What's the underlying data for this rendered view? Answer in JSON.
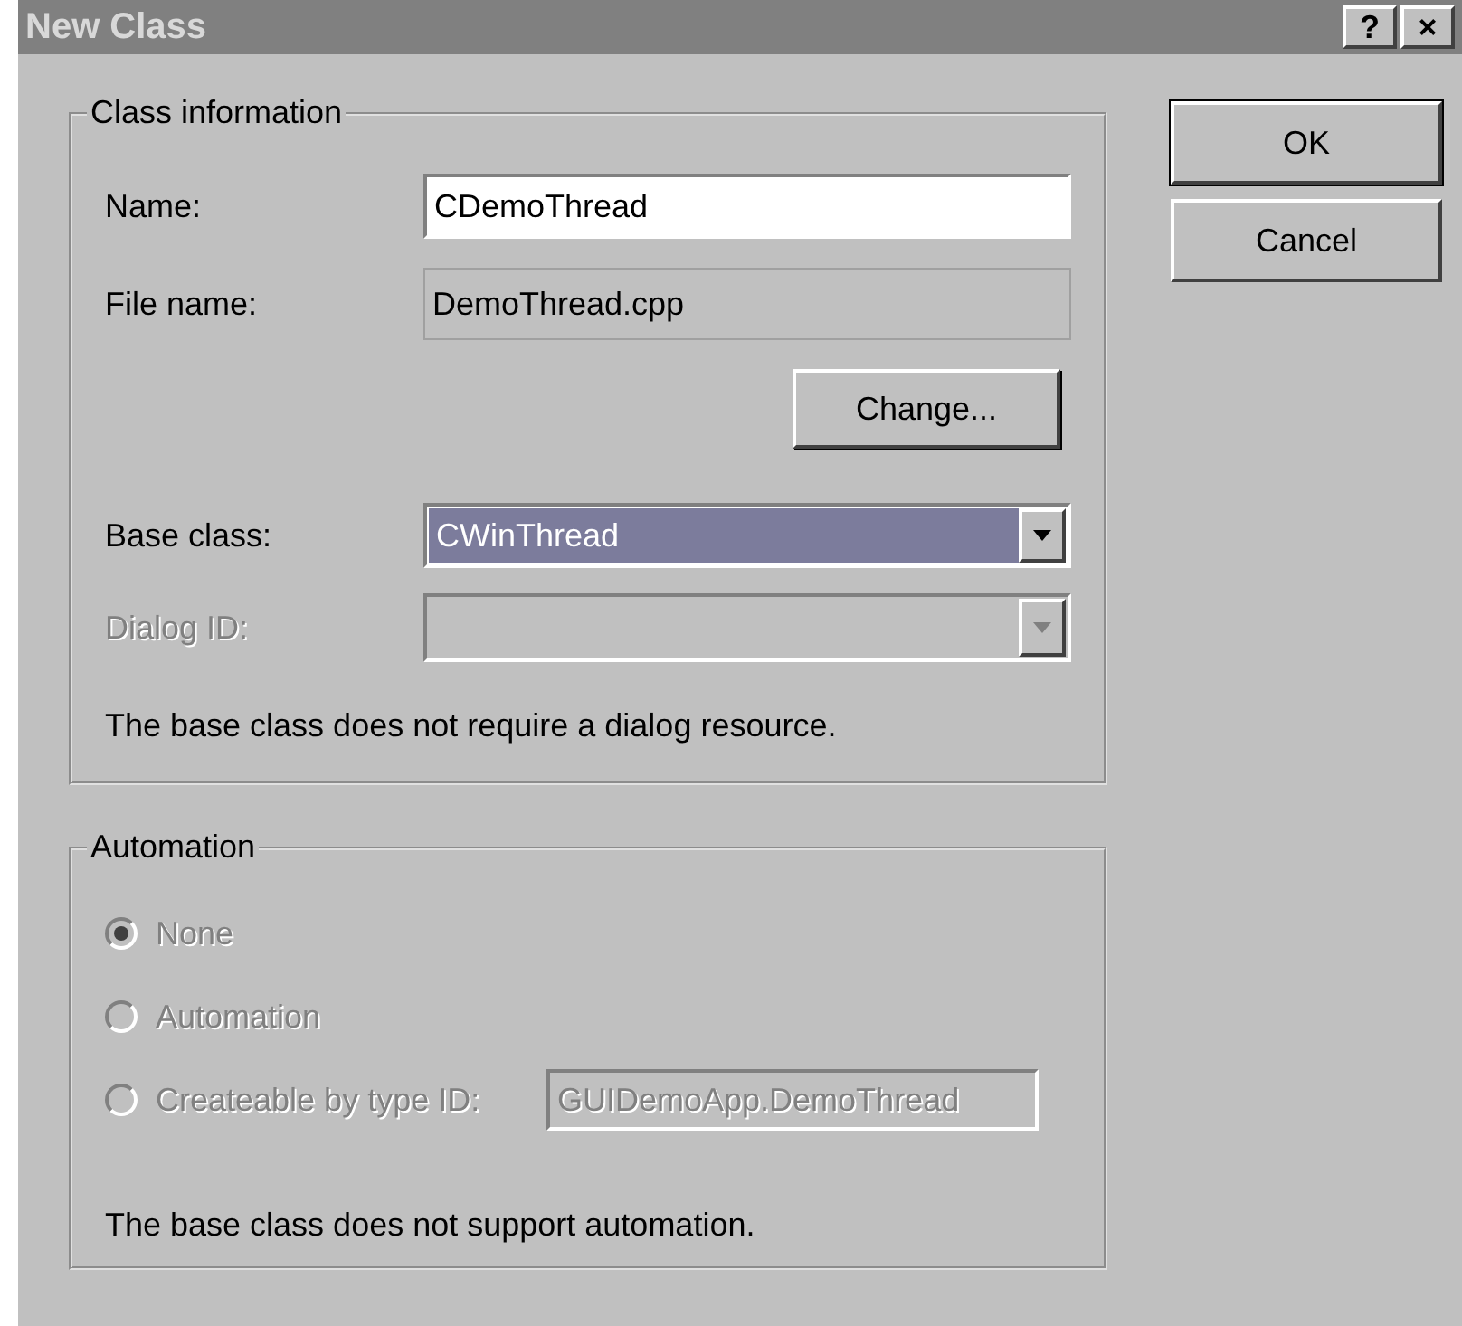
{
  "window": {
    "title": "New Class",
    "help_button": "?",
    "close_button": "×"
  },
  "class_info": {
    "legend": "Class information",
    "name": {
      "label": "Name:",
      "value": "CDemoThread"
    },
    "file_name": {
      "label": "File name:",
      "value": "DemoThread.cpp"
    },
    "change_button": "Change...",
    "base_class": {
      "label": "Base class:",
      "value": "CWinThread",
      "disabled": false
    },
    "dialog_id": {
      "label": "Dialog ID:",
      "disabled": true
    },
    "note": "The base class does not require a dialog resource."
  },
  "automation": {
    "legend": "Automation",
    "options": [
      {
        "label": "None",
        "selected": true,
        "disabled": true
      },
      {
        "label": "Automation",
        "selected": false,
        "disabled": true
      },
      {
        "label": "Createable by type ID:",
        "selected": false,
        "disabled": true
      }
    ],
    "type_id": {
      "value": "GUIDemoApp.DemoThread",
      "disabled": true
    },
    "note": "The base class does not support automation."
  },
  "buttons": [
    {
      "label": "OK",
      "default": true
    },
    {
      "label": "Cancel",
      "default": false
    }
  ]
}
